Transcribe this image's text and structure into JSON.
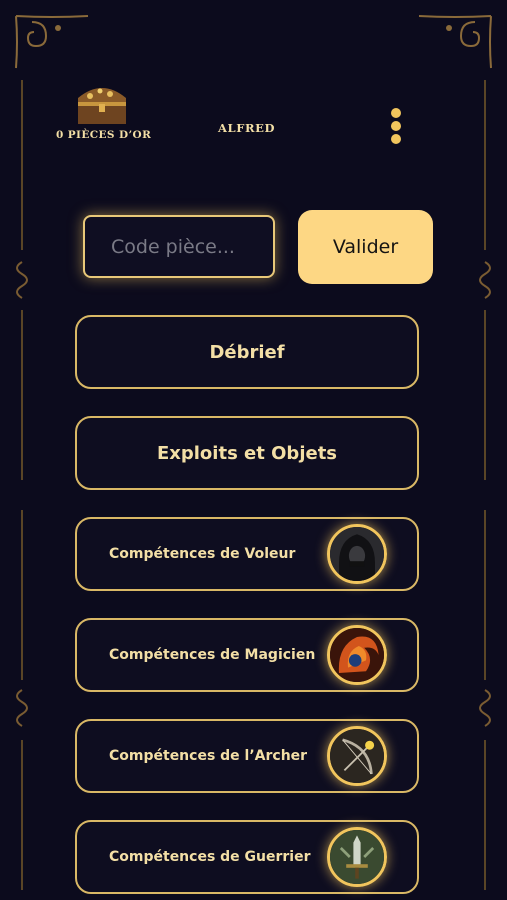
{
  "header": {
    "gold_label": "0 PIÈCES D’OR",
    "player_name": "ALFRED",
    "chest_icon": "treasure-chest-icon",
    "menu_icon": "vertical-dots-icon"
  },
  "code_entry": {
    "placeholder": "Code pièce...",
    "value": "",
    "submit_label": "Valider"
  },
  "menu": {
    "debrief_label": "Débrief",
    "exploits_label": "Exploits et Objets"
  },
  "skills": [
    {
      "label": "Compétences de Voleur",
      "icon": "hooded-thief-icon"
    },
    {
      "label": "Compétences de Magicien",
      "icon": "fire-magic-icon"
    },
    {
      "label": "Compétences de l’Archer",
      "icon": "bow-archer-icon"
    },
    {
      "label": "Compétences de Guerrier",
      "icon": "sword-warrior-icon"
    }
  ],
  "colors": {
    "background": "#0c0b1d",
    "accent_gold": "#f1c55d",
    "button_fill": "#fdd784",
    "text_gold": "#f3dfa6",
    "border_gold": "#d9b866"
  }
}
